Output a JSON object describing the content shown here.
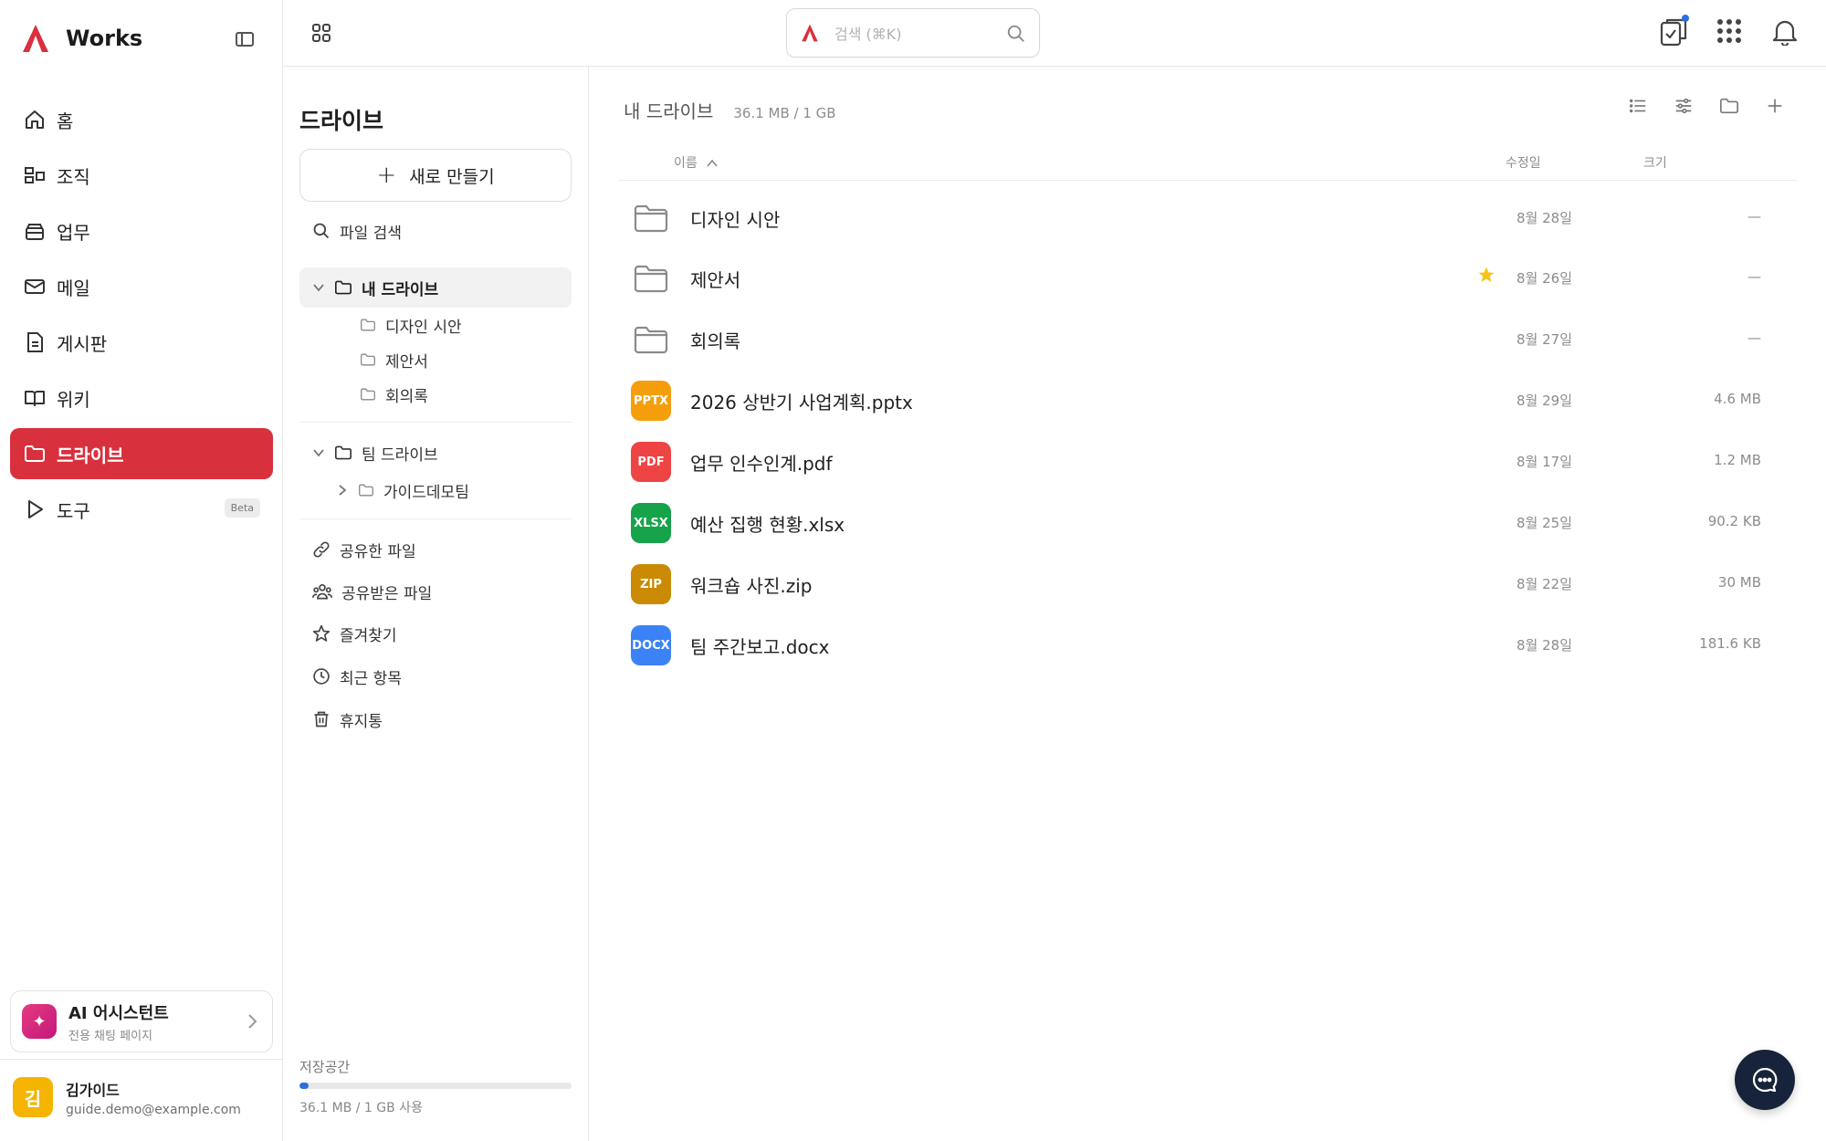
{
  "app": {
    "name": "Works",
    "brand_color": "#d9303e"
  },
  "nav": {
    "items": [
      {
        "label": "홈",
        "icon": "home-icon"
      },
      {
        "label": "조직",
        "icon": "org-icon"
      },
      {
        "label": "업무",
        "icon": "task-icon"
      },
      {
        "label": "메일",
        "icon": "mail-icon"
      },
      {
        "label": "게시판",
        "icon": "board-icon"
      },
      {
        "label": "위키",
        "icon": "wiki-icon"
      },
      {
        "label": "드라이브",
        "icon": "drive-icon",
        "active": true
      },
      {
        "label": "도구",
        "icon": "tool-icon",
        "badge": "Beta"
      }
    ]
  },
  "ai": {
    "title": "AI 어시스턴트",
    "subtitle": "전용 채팅 페이지"
  },
  "user": {
    "initial": "김",
    "name": "김가이드",
    "email": "guide.demo@example.com"
  },
  "search": {
    "placeholder": "검색 (⌘K)"
  },
  "drive_panel": {
    "title": "드라이브",
    "new_label": "새로 만들기",
    "search_label": "파일 검색",
    "my_drive": "내 드라이브",
    "my_folders": [
      "디자인 시안",
      "제안서",
      "회의록"
    ],
    "team_drive": "팀 드라이브",
    "team_folders": [
      "가이드데모팀"
    ],
    "links": [
      {
        "label": "공유한 파일",
        "icon": "link-icon"
      },
      {
        "label": "공유받은 파일",
        "icon": "people-icon"
      },
      {
        "label": "즐겨찾기",
        "icon": "star-icon"
      },
      {
        "label": "최근 항목",
        "icon": "clock-icon"
      },
      {
        "label": "휴지통",
        "icon": "trash-icon"
      }
    ],
    "storage_label": "저장공간",
    "storage_text": "36.1 MB / 1 GB 사용",
    "storage_used_fraction": 0.035
  },
  "main": {
    "title": "내 드라이브",
    "size": "36.1 MB / 1 GB",
    "columns": {
      "name": "이름",
      "modified": "수정일",
      "size": "크기"
    },
    "files": [
      {
        "name": "디자인 시안",
        "type": "folder",
        "date": "8월 28일",
        "size": "—"
      },
      {
        "name": "제안서",
        "type": "folder",
        "date": "8월 26일",
        "size": "—",
        "starred": true
      },
      {
        "name": "회의록",
        "type": "folder",
        "date": "8월 27일",
        "size": "—"
      },
      {
        "name": "2026 상반기 사업계획.pptx",
        "type": "file",
        "badge": "PPTX",
        "color": "#f59e0b",
        "date": "8월 29일",
        "size": "4.6 MB"
      },
      {
        "name": "업무 인수인계.pdf",
        "type": "file",
        "badge": "PDF",
        "color": "#ef4444",
        "date": "8월 17일",
        "size": "1.2 MB"
      },
      {
        "name": "예산 집행 현황.xlsx",
        "type": "file",
        "badge": "XLSX",
        "color": "#16a34a",
        "date": "8월 25일",
        "size": "90.2 KB"
      },
      {
        "name": "워크숍 사진.zip",
        "type": "file",
        "badge": "ZIP",
        "color": "#ca8a04",
        "date": "8월 22일",
        "size": "30 MB"
      },
      {
        "name": "팀 주간보고.docx",
        "type": "file",
        "badge": "DOCX",
        "color": "#3b82f6",
        "date": "8월 28일",
        "size": "181.6 KB"
      }
    ]
  }
}
